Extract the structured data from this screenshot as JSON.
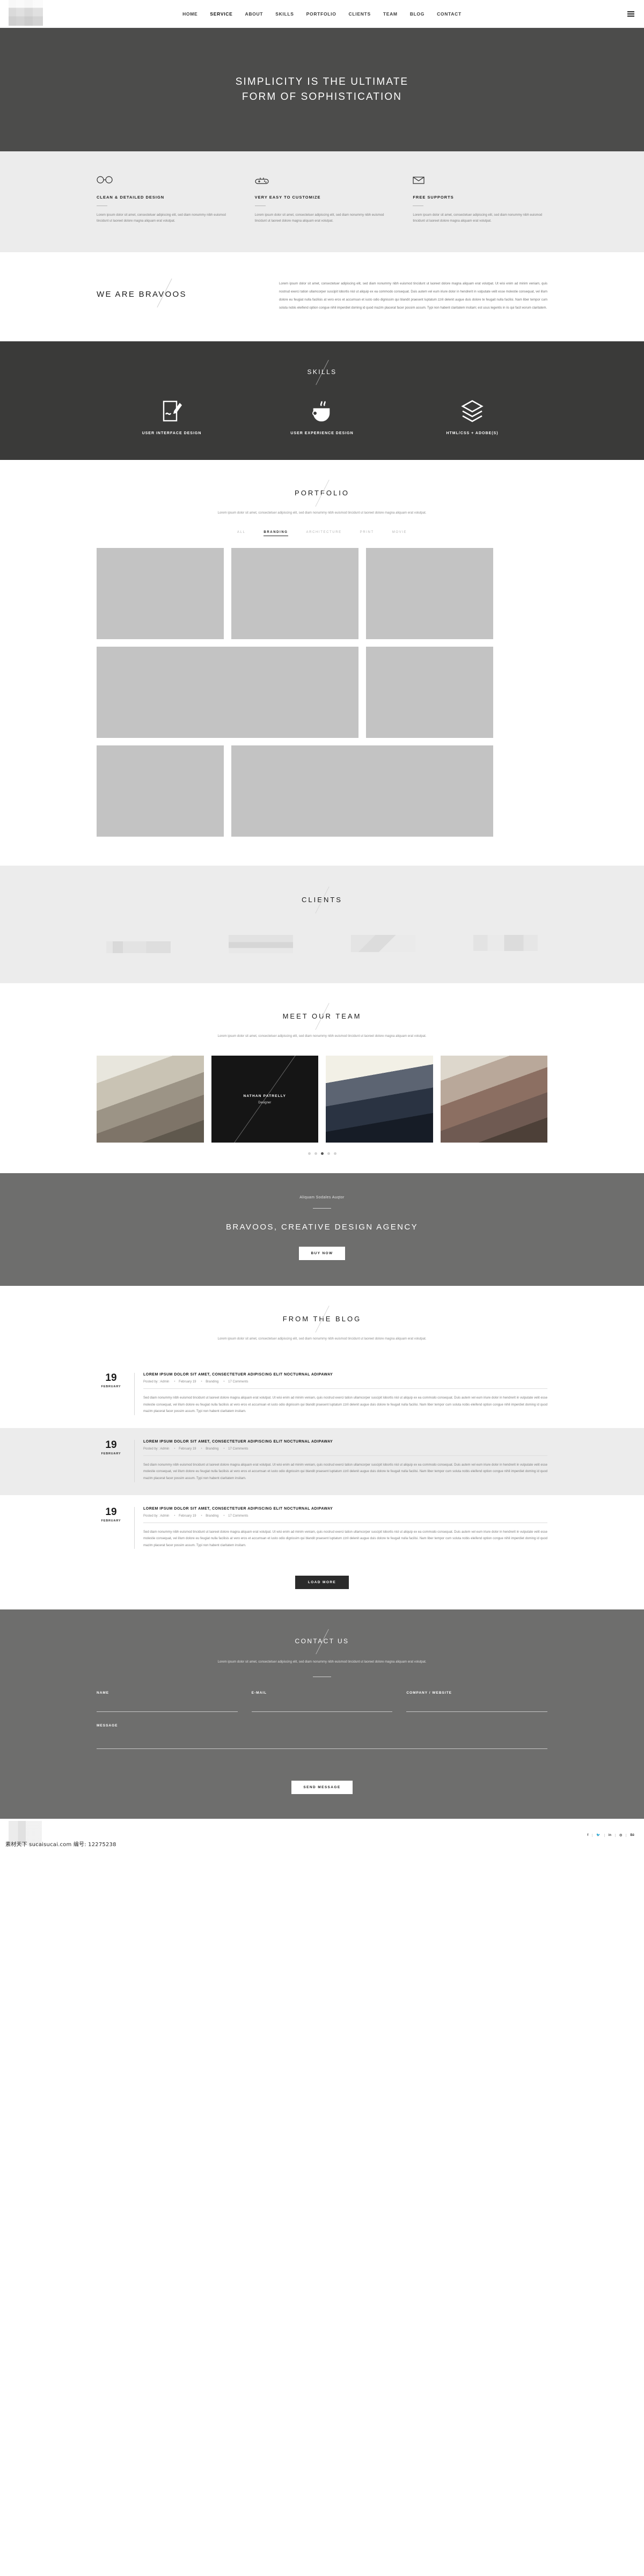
{
  "header": {
    "logo_alt": "bravoos-logo",
    "nav": [
      {
        "label": "HOME",
        "active": false
      },
      {
        "label": "SERVICE",
        "active": true
      },
      {
        "label": "ABOUT",
        "active": false
      },
      {
        "label": "SKILLS",
        "active": false
      },
      {
        "label": "PORTFOLIO",
        "active": false
      },
      {
        "label": "CLIENTS",
        "active": false
      },
      {
        "label": "TEAM",
        "active": false
      },
      {
        "label": "BLOG",
        "active": false
      },
      {
        "label": "CONTACT",
        "active": false
      }
    ]
  },
  "hero": {
    "line1": "SIMPLICITY IS THE ULTIMATE",
    "line2": "FORM OF SOPHISTICATION"
  },
  "services": {
    "items": [
      {
        "icon": "glasses-icon",
        "title": "CLEAN & DETAILED DESIGN",
        "text": "Lorem ipsum dolor sit amet, consectetuer adipiscing elit, sed diam nonummy nibh euismod tincidunt ut laoreet dolore magna aliquam erat volutpat."
      },
      {
        "icon": "gamepad-icon",
        "title": "VERY EASY TO CUSTOMIZE",
        "text": "Lorem ipsum dolor sit amet, consectetuer adipiscing elit, sed diam nonummy nibh euismod tincidunt ut laoreet dolore magna aliquam erat volutpat."
      },
      {
        "icon": "envelope-icon",
        "title": "FREE SUPPORTS",
        "text": "Lorem ipsum dolor sit amet, consectetuer adipiscing elit, sed diam nonummy nibh euismod tincidunt ut laoreet dolore magna aliquam erat volutpat."
      }
    ]
  },
  "about": {
    "title": "WE ARE BRAVOOS",
    "body": "Lorem ipsum dolor sit amet, consectetuer adipiscing elit, sed diam nonummy nibh euismod tincidunt ut laoreet dolore magna aliquam erat volutpat. Ut wisi enim ad minim veniam, quis nostrud exerci tation ullamcorper suscipit lobortis nisl ut aliquip ex ea commodo consequat. Duis autem vel eum iriure dolor in hendrerit in vulputate velit esse molestie consequat, vel illum dolore eu feugiat nulla facilisis at vero eros et accumsan et iusto odio dignissim qui blandit praesent luptatum zzril delenit augue duis dolore te feugait nulla facilisi. Nam liber tempor cum soluta nobis eleifend option congue nihil imperdiet doming id quod mazim placerat facer possim assum. Typi non habent claritatem insitam; est usus legentis in iis qui facit eorum claritatem."
  },
  "skills": {
    "title": "SKILLS",
    "items": [
      {
        "icon": "pen-tablet-icon",
        "label": "USER INTERFACE DESIGN"
      },
      {
        "icon": "coffee-cup-icon",
        "label": "USER EXPERIENCE DESIGN"
      },
      {
        "icon": "layers-icon",
        "label": "HTML/CSS + ADOBE(S)"
      }
    ]
  },
  "portfolio": {
    "title": "PORTFOLIO",
    "subtitle": "Lorem ipsum dolor sit amet, consectetuer adipiscing elit, sed diam nonummy nibh euismod tincidunt ut laoreet dolore magna aliquam erat volutpat.",
    "filters": [
      {
        "label": "ALL",
        "active": false
      },
      {
        "label": "BRANDING",
        "active": true
      },
      {
        "label": "ARCHITECTURE",
        "active": false
      },
      {
        "label": "PRINT",
        "active": false
      },
      {
        "label": "MOVIE",
        "active": false
      }
    ],
    "items_count": 7
  },
  "clients": {
    "title": "CLIENTS",
    "logos": [
      "client-logo-1",
      "client-logo-2",
      "client-logo-3",
      "client-logo-4"
    ]
  },
  "team": {
    "title": "MEET OUR TEAM",
    "subtitle": "Lorem ipsum dolor sit amet, consectetuer adipiscing elit, sed diam nonummy nibh euismod tincidunt ut laoreet dolore magna aliquam erat volutpat.",
    "members": [
      {
        "name": "",
        "role": "",
        "hovered": false
      },
      {
        "name": "NATHAN PATRELLY",
        "role": "Designer",
        "hovered": true
      },
      {
        "name": "",
        "role": "",
        "hovered": false
      },
      {
        "name": "",
        "role": "",
        "hovered": false
      }
    ],
    "dots": [
      false,
      false,
      true,
      false,
      false
    ]
  },
  "cta": {
    "kicker": "Aliquam Sodales Auqtor",
    "headline": "BRAVOOS, CREATIVE DESIGN AGENCY",
    "button": "BUY NOW"
  },
  "blog": {
    "title": "FROM THE BLOG",
    "subtitle": "Lorem ipsum dolor sit amet, consectetuer adipiscing elit, sed diam nonummy nibh euismod tincidunt ut laoreet dolore magna aliquam erat volutpat.",
    "posts": [
      {
        "day": "19",
        "month": "FEBRUARY",
        "title": "LOREM IPSUM DOLOR SIT AMET, CONSECTETUER ADIPISCING ELIT NOCTURNAL ADIPAWAY",
        "author": "Posted by : Admin",
        "date": "February 19",
        "category": "Branding",
        "comments": "17 Comments",
        "excerpt": "Sed diam nonummy nibh euismod tincidunt ut laoreet dolore magna aliquam erat volutpat. Ut wisi enim ad minim veniam, quis nostrud exerci tation ullamcorper suscipit lobortis nisl ut aliquip ex ea commodo consequat. Duis autem vel eum iriure dolor in hendrerit in vulputate velit esse molestie consequat, vel illum dolore eu feugiat nulla facilisis at vero eros et accumsan et iusto odio dignissim qui blandit praesent luptatum zzril delenit augue duis dolore te feugait nulla facilisi. Nam liber tempor cum soluta nobis eleifend option congue nihil imperdiet doming id quod mazim placerat facer possim assum. Typi non habent claritatem insitam."
      },
      {
        "day": "19",
        "month": "FEBRUARY",
        "title": "LOREM IPSUM DOLOR SIT AMET, CONSECTETUER ADIPISCING ELIT NOCTURNAL ADIPAWAY",
        "author": "Posted by : Admin",
        "date": "February 19",
        "category": "Branding",
        "comments": "17 Comments",
        "excerpt": "Sed diam nonummy nibh euismod tincidunt ut laoreet dolore magna aliquam erat volutpat. Ut wisi enim ad minim veniam, quis nostrud exerci tation ullamcorper suscipit lobortis nisl ut aliquip ex ea commodo consequat. Duis autem vel eum iriure dolor in hendrerit in vulputate velit esse molestie consequat, vel illum dolore eu feugiat nulla facilisis at vero eros et accumsan et iusto odio dignissim qui blandit praesent luptatum zzril delenit augue duis dolore te feugait nulla facilisi. Nam liber tempor cum soluta nobis eleifend option congue nihil imperdiet doming id quod mazim placerat facer possim assum. Typi non habent claritatem insitam."
      },
      {
        "day": "19",
        "month": "FEBRUARY",
        "title": "LOREM IPSUM DOLOR SIT AMET, CONSECTETUER ADIPISCING ELIT NOCTURNAL ADIPAWAY",
        "author": "Posted by : Admin",
        "date": "February 19",
        "category": "Branding",
        "comments": "17 Comments",
        "excerpt": "Sed diam nonummy nibh euismod tincidunt ut laoreet dolore magna aliquam erat volutpat. Ut wisi enim ad minim veniam, quis nostrud exerci tation ullamcorper suscipit lobortis nisl ut aliquip ex ea commodo consequat. Duis autem vel eum iriure dolor in hendrerit in vulputate velit esse molestie consequat, vel illum dolore eu feugiat nulla facilisis at vero eros et accumsan et iusto odio dignissim qui blandit praesent luptatum zzril delenit augue duis dolore te feugait nulla facilisi. Nam liber tempor cum soluta nobis eleifend option congue nihil imperdiet doming id quod mazim placerat facer possim assum. Typi non habent claritatem insitam."
      }
    ],
    "load_more": "LOAD MORE"
  },
  "contact": {
    "title": "CONTACT US",
    "subtitle": "Lorem ipsum dolor sit amet, consectetuer adipiscing elit, sed diam nonummy nibh euismod tincidunt ut laoreet dolore magna aliquam erat volutpat.",
    "fields": {
      "name_label": "NAME",
      "name_value": "",
      "email_label": "E-MAIL",
      "email_value": "",
      "company_label": "COMPANY / WEBSITE",
      "company_value": "",
      "message_label": "MESSAGE",
      "message_value": ""
    },
    "submit": "SEND MESSAGE"
  },
  "footer": {
    "watermark": "素材天下 sucaisucai.com 编号: 12275238",
    "socials": [
      {
        "icon": "facebook-icon",
        "glyph": "f"
      },
      {
        "icon": "twitter-icon",
        "glyph": "🐦"
      },
      {
        "icon": "linkedin-icon",
        "glyph": "in"
      },
      {
        "icon": "instagram-icon",
        "glyph": "◎"
      },
      {
        "icon": "behance-icon",
        "glyph": "Bē"
      }
    ]
  },
  "colors": {
    "hero_bg": "#4c4c4b",
    "skills_bg": "#3a3a39",
    "light_bg": "#ececec",
    "cta_bg": "#6e6e6d",
    "dark_btn": "#2b2b2b",
    "placeholder": "#c3c3c3"
  }
}
